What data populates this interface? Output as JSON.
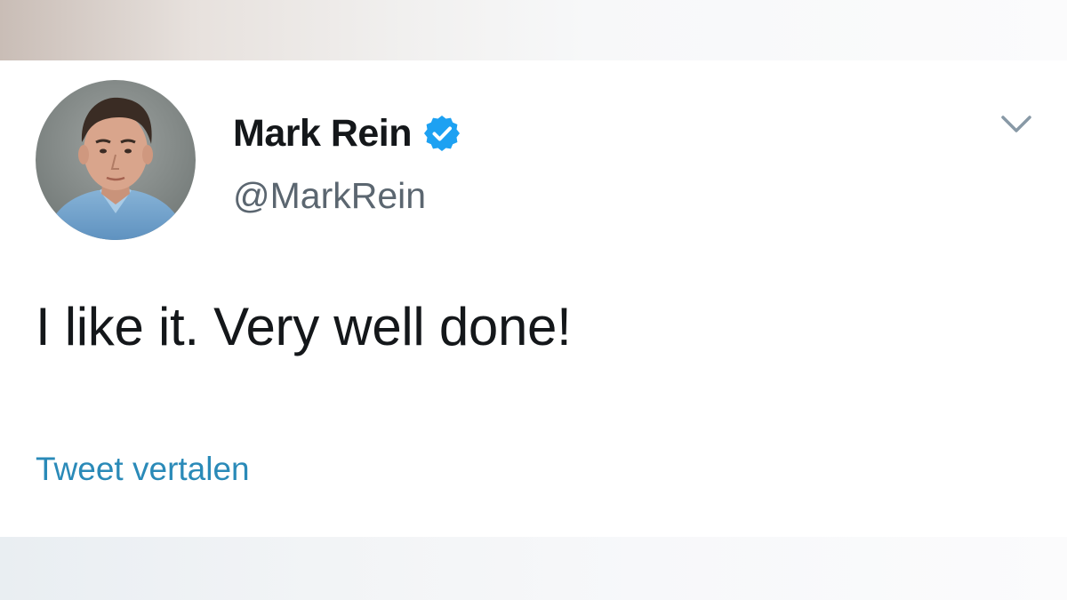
{
  "tweet": {
    "author": {
      "display_name": "Mark Rein",
      "handle": "@MarkRein",
      "verified": true,
      "avatar_icon": "profile-photo"
    },
    "text": "I like it. Very well done!",
    "translate_label": "Tweet vertalen",
    "menu_icon": "chevron-down-icon"
  },
  "colors": {
    "name": "#14171a",
    "handle": "#5b6670",
    "link": "#2a8ab8",
    "verified_badge": "#1da1f2"
  }
}
